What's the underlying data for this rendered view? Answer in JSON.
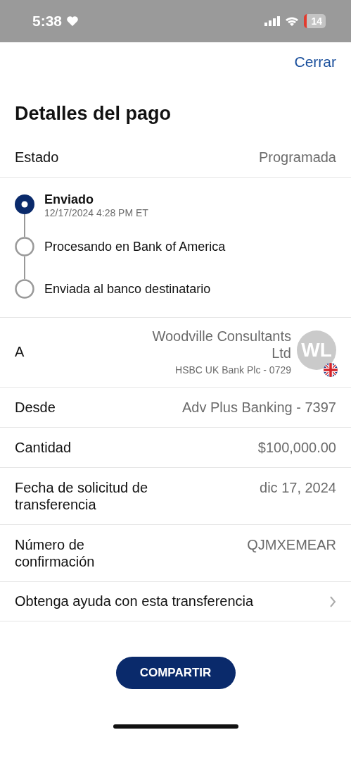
{
  "status_bar": {
    "time": "5:38",
    "battery": "14"
  },
  "close_label": "Cerrar",
  "title": "Detalles del pago",
  "status_row": {
    "label": "Estado",
    "value": "Programada"
  },
  "timeline": [
    {
      "label": "Enviado",
      "detail": "12/17/2024 4:28 PM ET",
      "completed": true
    },
    {
      "label": "Procesando en Bank of America",
      "completed": false
    },
    {
      "label": "Enviada al banco destinatario",
      "completed": false
    }
  ],
  "recipient": {
    "label": "A",
    "name": "Woodville Consultants Ltd",
    "bank": "HSBC UK Bank Plc - 0729",
    "initials": "WL"
  },
  "details": [
    {
      "label": "Desde",
      "value": "Adv Plus Banking - 7397"
    },
    {
      "label": "Cantidad",
      "value": "$100,000.00"
    },
    {
      "label": "Fecha de solicitud de transferencia",
      "value": "dic 17, 2024"
    },
    {
      "label": "Número de confirmación",
      "value": "QJMXEMEAR"
    }
  ],
  "help_link": "Obtenga ayuda con esta transferencia",
  "share_button": "COMPARTIR"
}
